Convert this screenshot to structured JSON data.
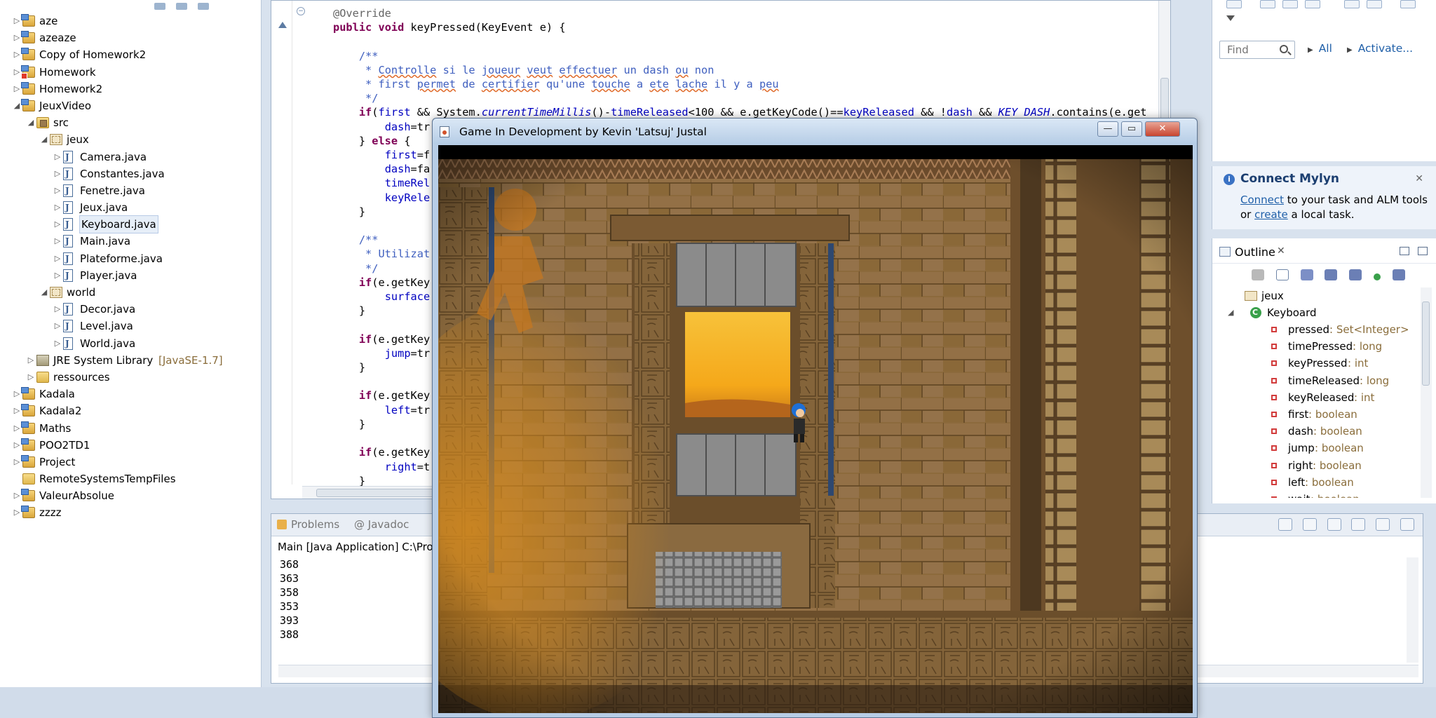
{
  "explorer": {
    "items": [
      {
        "label": "aze",
        "icon": "project-icon",
        "kind": "project",
        "expanded": false,
        "depth": 0
      },
      {
        "label": "azeaze",
        "icon": "project-icon",
        "kind": "project",
        "expanded": false,
        "depth": 0
      },
      {
        "label": "Copy of Homework2",
        "icon": "project-icon",
        "kind": "project",
        "expanded": false,
        "depth": 0
      },
      {
        "label": "Homework",
        "icon": "project-error-icon",
        "kind": "project-err",
        "expanded": false,
        "depth": 0
      },
      {
        "label": "Homework2",
        "icon": "project-icon",
        "kind": "project",
        "expanded": false,
        "depth": 0
      },
      {
        "label": "JeuxVideo",
        "icon": "project-icon",
        "kind": "project",
        "expanded": true,
        "depth": 0
      },
      {
        "label": "src",
        "icon": "source-folder-icon",
        "kind": "srcfolder",
        "expanded": true,
        "depth": 1
      },
      {
        "label": "jeux",
        "icon": "package-icon",
        "kind": "package",
        "expanded": true,
        "depth": 2
      },
      {
        "label": "Camera.java",
        "icon": "java-file-icon",
        "kind": "jfile",
        "expanded": false,
        "depth": 3
      },
      {
        "label": "Constantes.java",
        "icon": "java-file-icon",
        "kind": "jfile",
        "expanded": false,
        "depth": 3
      },
      {
        "label": "Fenetre.java",
        "icon": "java-file-icon",
        "kind": "jfile",
        "expanded": false,
        "depth": 3
      },
      {
        "label": "Jeux.java",
        "icon": "java-file-icon",
        "kind": "jfile",
        "expanded": false,
        "depth": 3
      },
      {
        "label": "Keyboard.java",
        "icon": "java-file-icon",
        "kind": "jfile",
        "expanded": false,
        "depth": 3,
        "selected": true
      },
      {
        "label": "Main.java",
        "icon": "java-file-icon",
        "kind": "jfile",
        "expanded": false,
        "depth": 3
      },
      {
        "label": "Plateforme.java",
        "icon": "java-file-icon",
        "kind": "jfile",
        "expanded": false,
        "depth": 3
      },
      {
        "label": "Player.java",
        "icon": "java-file-icon",
        "kind": "jfile",
        "expanded": false,
        "depth": 3
      },
      {
        "label": "world",
        "icon": "package-icon",
        "kind": "package",
        "expanded": true,
        "depth": 2
      },
      {
        "label": "Decor.java",
        "icon": "java-file-icon",
        "kind": "jfile",
        "expanded": false,
        "depth": 3
      },
      {
        "label": "Level.java",
        "icon": "java-file-icon",
        "kind": "jfile",
        "expanded": false,
        "depth": 3
      },
      {
        "label": "World.java",
        "icon": "java-file-icon",
        "kind": "jfile",
        "expanded": false,
        "depth": 3
      },
      {
        "label": "JRE System Library",
        "decoration": "[JavaSE-1.7]",
        "icon": "library-icon",
        "kind": "library",
        "expanded": false,
        "depth": 1
      },
      {
        "label": "ressources",
        "icon": "folder-icon",
        "kind": "folder",
        "expanded": false,
        "depth": 1
      },
      {
        "label": "Kadala",
        "icon": "project-icon",
        "kind": "project",
        "expanded": false,
        "depth": 0
      },
      {
        "label": "Kadala2",
        "icon": "project-icon",
        "kind": "project",
        "expanded": false,
        "depth": 0
      },
      {
        "label": "Maths",
        "icon": "project-icon",
        "kind": "project",
        "expanded": false,
        "depth": 0
      },
      {
        "label": "POO2TD1",
        "icon": "project-icon",
        "kind": "project",
        "expanded": false,
        "depth": 0
      },
      {
        "label": "Project",
        "icon": "project-icon",
        "kind": "project",
        "expanded": false,
        "depth": 0
      },
      {
        "label": "RemoteSystemsTempFiles",
        "icon": "folder-icon",
        "kind": "folder",
        "expanded": false,
        "depth": 0,
        "noarrow": true
      },
      {
        "label": "ValeurAbsolue",
        "icon": "project-icon",
        "kind": "project",
        "expanded": false,
        "depth": 0
      },
      {
        "label": "zzzz",
        "icon": "project-icon",
        "kind": "project",
        "expanded": false,
        "depth": 0
      }
    ]
  },
  "editor": {
    "code": {
      "l1": "@Override",
      "l2_kw1": "public",
      "l2_kw2": "void",
      "l2_rest": " keyPressed(KeyEvent e) {",
      "c1": "/**",
      "c2a": " * ",
      "c2b": "Controlle",
      "c2c": " si le ",
      "c2d": "joueur",
      "c2e": " ",
      "c2f": "veut",
      "c2g": " ",
      "c2h": "effectuer",
      "c2i": " un dash ",
      "c2j": "ou",
      "c2k": " non",
      "c3a": " * first ",
      "c3b": "permet",
      "c3c": " de ",
      "c3d": "certifier",
      "c3e": " qu'une ",
      "c3f": "touche",
      "c3g": " a ",
      "c3h": "ete",
      "c3i": " ",
      "c3j": "lache",
      "c3k": " il y a ",
      "c3l": "peu",
      "c4": " */",
      "if1_kw": "if",
      "if1_a": "(",
      "if1_first": "first",
      "if1_b": " && System.",
      "if1_ctm": "currentTimeMillis",
      "if1_c": "()-",
      "if1_tr": "timeReleased",
      "if1_d": "<100 && e.getKeyCode()==",
      "if1_kr": "keyReleased",
      "if1_e": " && !",
      "if1_dash": "dash",
      "if1_f": " && ",
      "if1_kd": "KEY_DASH",
      "if1_g": ".contains(e.get",
      "dash_true": "dash",
      "dash_true_rest": "=tr",
      "else_a": "} ",
      "else_kw": "else",
      "else_b": " {",
      "first_f": "first",
      "first_f_rest": "=f",
      "dash_f": "dash",
      "dash_f_rest": "=fa",
      "timerel": "timeRel",
      "keyrel": "keyRele",
      "close1": "}",
      "c5": "/**",
      "c6": " * Utilizat",
      "c7": " */",
      "if2_kw": "if",
      "if2_rest": "(e.getKey",
      "surface": "surface",
      "close2": "}",
      "if3_kw": "if",
      "if3_rest": "(e.getKey",
      "jump": "jump",
      "jump_rest": "=tr",
      "close3": "}",
      "if4_kw": "if",
      "if4_rest": "(e.getKey",
      "left": "left",
      "left_rest": "=tr",
      "close4": "}",
      "if5_kw": "if",
      "if5_rest": "(e.getKey",
      "right": "right",
      "right_rest": "=t",
      "close5": "}"
    }
  },
  "console": {
    "tabs": [
      {
        "label": "Problems",
        "icon": "problems-icon"
      },
      {
        "label": "@ Javadoc",
        "icon": "javadoc-icon"
      }
    ],
    "path": "Main [Java Application] C:\\Prog",
    "lines": "368\n363\n358\n353\n393\n388"
  },
  "find": {
    "placeholder": "Find",
    "all_label": "All",
    "activate_label": "Activate..."
  },
  "mylyn": {
    "title": "Connect Mylyn",
    "connect_link": "Connect",
    "text1": " to your task and ALM tools or ",
    "create_link": "create",
    "text2": " a local task."
  },
  "outline": {
    "tab_label": "Outline",
    "package_label": "jeux",
    "class_label": "Keyboard",
    "fields": [
      {
        "name": "pressed",
        "type": "Set<Integer>",
        "final": true
      },
      {
        "name": "timePressed",
        "type": "long"
      },
      {
        "name": "keyPressed",
        "type": "int"
      },
      {
        "name": "timeReleased",
        "type": "long"
      },
      {
        "name": "keyReleased",
        "type": "int"
      },
      {
        "name": "first",
        "type": "boolean"
      },
      {
        "name": "dash",
        "type": "boolean"
      },
      {
        "name": "jump",
        "type": "boolean"
      },
      {
        "name": "right",
        "type": "boolean"
      },
      {
        "name": "left",
        "type": "boolean"
      },
      {
        "name": "wait",
        "type": "boolean"
      }
    ]
  },
  "game": {
    "title": "Game In Development by Kevin 'Latsuj' Justal",
    "minimize_label": "—",
    "maximize_label": "▭",
    "close_label": "✕"
  },
  "colors": {
    "stone": "#8c6a3c",
    "stone_dark": "#5e4424",
    "sand": "#c98a2a",
    "sunlight": "#f5b21f",
    "player_hair": "#1e6fd6"
  }
}
